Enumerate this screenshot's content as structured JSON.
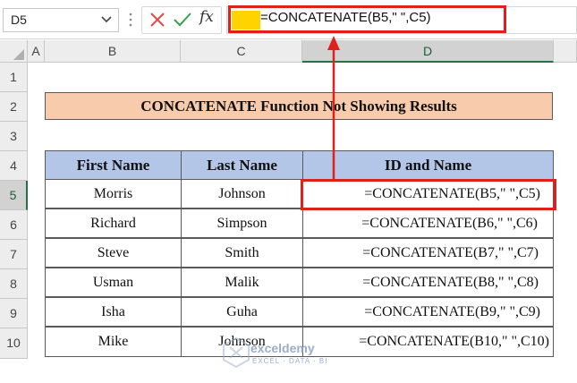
{
  "formula_bar": {
    "name_box": "D5",
    "formula": "=CONCATENATE(B5,\" \",C5)",
    "fx_label": "fx"
  },
  "columns": [
    "A",
    "B",
    "C",
    "D"
  ],
  "rows": [
    "1",
    "2",
    "3",
    "4",
    "5",
    "6",
    "7",
    "8",
    "9",
    "10"
  ],
  "title": "CONCATENATE Function Not Showing Results",
  "table": {
    "headers": [
      "First Name",
      "Last Name",
      "ID and Name"
    ],
    "rows": [
      [
        "Morris",
        "Johnson",
        "=CONCATENATE(B5,\" \",C5)"
      ],
      [
        "Richard",
        "Simpson",
        "=CONCATENATE(B6,\" \",C6)"
      ],
      [
        "Steve",
        "Smith",
        "=CONCATENATE(B7,\" \",C7)"
      ],
      [
        "Usman",
        "Malik",
        "=CONCATENATE(B8,\" \",C8)"
      ],
      [
        "Isha",
        "Guha",
        "=CONCATENATE(B9,\" \",C9)"
      ],
      [
        "Mike",
        "Johnson",
        "=CONCATENATE(B10,\" \",C10)"
      ]
    ]
  },
  "watermark": {
    "name": "exceldemy",
    "tagline": "EXCEL · DATA · BI"
  },
  "colors": {
    "highlight_red": "#e0201b",
    "title_fill": "#f8cbad",
    "header_fill": "#b4c6e7",
    "selected_header": "#217346"
  }
}
